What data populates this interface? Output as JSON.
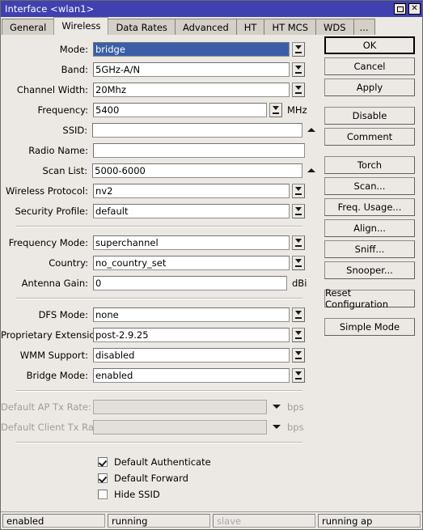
{
  "window": {
    "title": "Interface <wlan1>",
    "maximize_label": "maximize-box",
    "close_label": "✕"
  },
  "tabs": [
    {
      "label": "General",
      "active": false
    },
    {
      "label": "Wireless",
      "active": true
    },
    {
      "label": "Data Rates",
      "active": false
    },
    {
      "label": "Advanced",
      "active": false
    },
    {
      "label": "HT",
      "active": false
    },
    {
      "label": "HT MCS",
      "active": false
    },
    {
      "label": "WDS",
      "active": false
    },
    {
      "label": "...",
      "active": false
    }
  ],
  "fields": {
    "mode": {
      "label": "Mode:",
      "value": "bridge"
    },
    "band": {
      "label": "Band:",
      "value": "5GHz-A/N"
    },
    "channel_width": {
      "label": "Channel Width:",
      "value": "20Mhz"
    },
    "frequency": {
      "label": "Frequency:",
      "value": "5400",
      "unit": "MHz"
    },
    "ssid": {
      "label": "SSID:",
      "value": ""
    },
    "radio_name": {
      "label": "Radio Name:",
      "value": ""
    },
    "scan_list": {
      "label": "Scan List:",
      "value": "5000-6000"
    },
    "wireless_protocol": {
      "label": "Wireless Protocol:",
      "value": "nv2"
    },
    "security_profile": {
      "label": "Security Profile:",
      "value": "default"
    },
    "frequency_mode": {
      "label": "Frequency Mode:",
      "value": "superchannel"
    },
    "country": {
      "label": "Country:",
      "value": "no_country_set"
    },
    "antenna_gain": {
      "label": "Antenna Gain:",
      "value": "0",
      "unit": "dBi"
    },
    "dfs_mode": {
      "label": "DFS Mode:",
      "value": "none"
    },
    "proprietary_extensions": {
      "label": "Proprietary Extensions:",
      "value": "post-2.9.25"
    },
    "wmm_support": {
      "label": "WMM Support:",
      "value": "disabled"
    },
    "bridge_mode": {
      "label": "Bridge Mode:",
      "value": "enabled"
    },
    "default_ap_tx_rate": {
      "label": "Default AP Tx Rate:",
      "value": "",
      "unit": "bps"
    },
    "default_client_tx_rate": {
      "label": "Default Client Tx Rate:",
      "value": "",
      "unit": "bps"
    }
  },
  "checkboxes": [
    {
      "label": "Default Authenticate",
      "checked": true
    },
    {
      "label": "Default Forward",
      "checked": true
    },
    {
      "label": "Hide SSID",
      "checked": false
    }
  ],
  "buttons": [
    {
      "label": "OK",
      "default": true,
      "gap_after": false
    },
    {
      "label": "Cancel",
      "default": false,
      "gap_after": false
    },
    {
      "label": "Apply",
      "default": false,
      "gap_after": true
    },
    {
      "label": "Disable",
      "default": false,
      "gap_after": false
    },
    {
      "label": "Comment",
      "default": false,
      "gap_after": true
    },
    {
      "label": "Torch",
      "default": false,
      "gap_after": false
    },
    {
      "label": "Scan...",
      "default": false,
      "gap_after": false
    },
    {
      "label": "Freq. Usage...",
      "default": false,
      "gap_after": false
    },
    {
      "label": "Align...",
      "default": false,
      "gap_after": false
    },
    {
      "label": "Sniff...",
      "default": false,
      "gap_after": false
    },
    {
      "label": "Snooper...",
      "default": false,
      "gap_after": true
    },
    {
      "label": "Reset Configuration",
      "default": false,
      "gap_after": true
    },
    {
      "label": "Simple Mode",
      "default": false,
      "gap_after": false
    }
  ],
  "statusbar": [
    {
      "text": "enabled",
      "dim": false
    },
    {
      "text": "running",
      "dim": false
    },
    {
      "text": "slave",
      "dim": true
    },
    {
      "text": "running ap",
      "dim": false
    }
  ],
  "colors": {
    "titlebar": "#4040b0",
    "selection": "#3a5fa8",
    "face": "#ece9e4",
    "tab_inactive": "#d4d0c8"
  }
}
